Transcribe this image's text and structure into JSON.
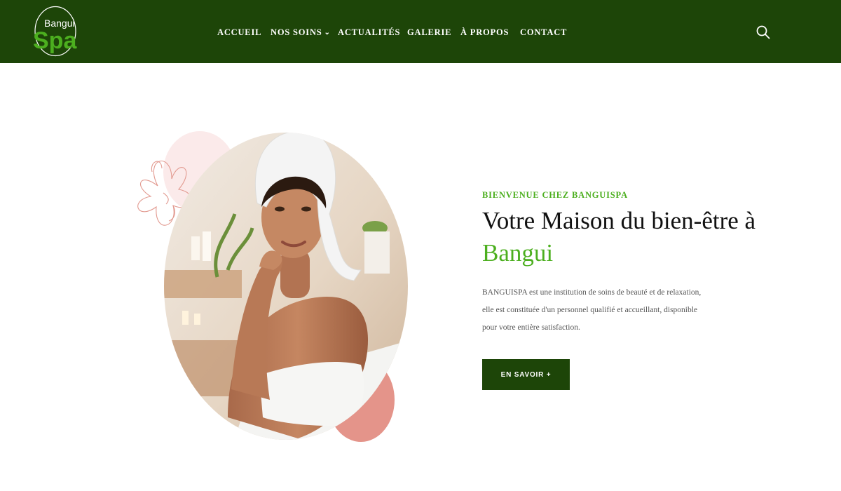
{
  "brand": {
    "logo_text_top": "Bangui",
    "logo_text_main": "Spa",
    "primary_color": "#1d4508",
    "accent_color": "#4caf1f"
  },
  "nav": {
    "items": [
      {
        "label": "ACCUEIL"
      },
      {
        "label": "NOS SOINS",
        "has_dropdown": true
      },
      {
        "label": "ACTUALITÉS"
      },
      {
        "label": "GALERIE"
      },
      {
        "label": "À PROPOS"
      },
      {
        "label": "CONTACT"
      }
    ],
    "search_icon": "search-icon"
  },
  "hero": {
    "eyebrow": "BIENVENUE CHEZ BANGUISPA",
    "title_main": "Votre Maison du bien-être à",
    "title_accent": "Bangui",
    "description": "BANGUISPA est une institution de soins de beauté et de relaxation, elle est constituée d'un personnel qualifié et accueillant, disponible pour votre entière satisfaction.",
    "cta_label": "EN SAVOIR +"
  }
}
